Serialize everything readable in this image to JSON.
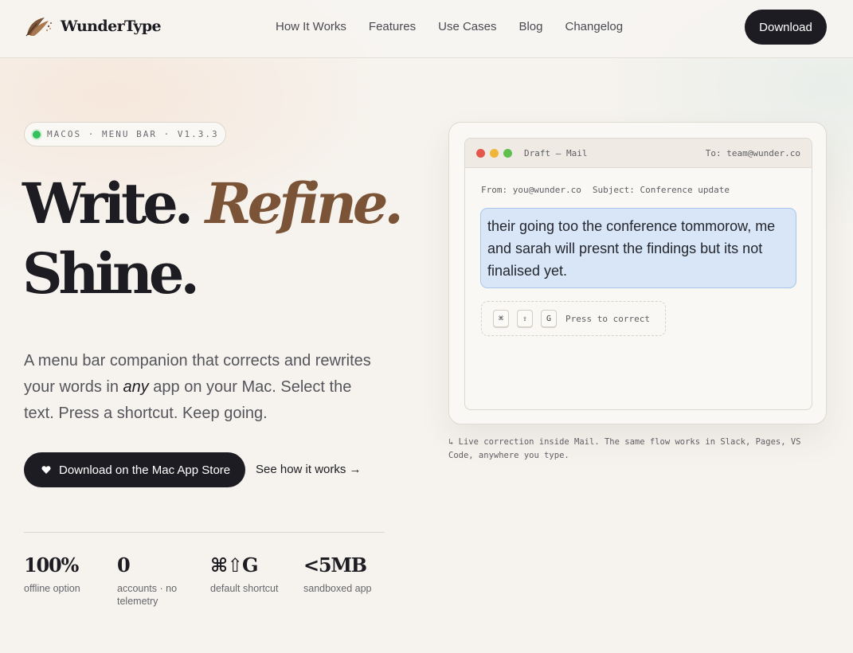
{
  "brand": {
    "name": "WunderType"
  },
  "nav": {
    "items": [
      "How It Works",
      "Features",
      "Use Cases",
      "Blog",
      "Changelog"
    ],
    "download_label": "Download"
  },
  "hero": {
    "badge": "MACOS · MENU BAR · V1.3.3",
    "headline_write": "Write.",
    "headline_refine": "Refine.",
    "headline_shine": "Shine.",
    "desc_before": "A menu bar companion that corrects and rewrites your words in ",
    "desc_em": "any",
    "desc_after": " app on your Mac. Select the text. Press a shortcut. Keep going.",
    "store_button": "Download on the Mac App Store",
    "how_link": "See how it works →"
  },
  "stats": [
    {
      "value": "100%",
      "label": "offline option"
    },
    {
      "value": "0",
      "label": "accounts · no telemetry"
    },
    {
      "value": "⌘⇧G",
      "label": "default shortcut"
    },
    {
      "value": "<5MB",
      "label": "sandboxed app"
    }
  ],
  "demo": {
    "window_title": "Draft — Mail",
    "to": "To: team@wunder.co",
    "from": "From: you@wunder.co",
    "subject": "Subject: Conference update",
    "draft_text": "their going too the conference tommorow, me and sarah will presnt the findings but its not finalised yet.",
    "keys": [
      "⌘",
      "⇧",
      "G"
    ],
    "hint": "Press to correct",
    "caption": "↳ Live correction inside Mail. The same flow works in Slack, Pages, VS Code, anywhere you type."
  },
  "colors": {
    "accent_brown": "#7b5337",
    "dark": "#1c1c22",
    "status_green": "#33c15a",
    "highlight_blue": "#d8e6f7"
  }
}
